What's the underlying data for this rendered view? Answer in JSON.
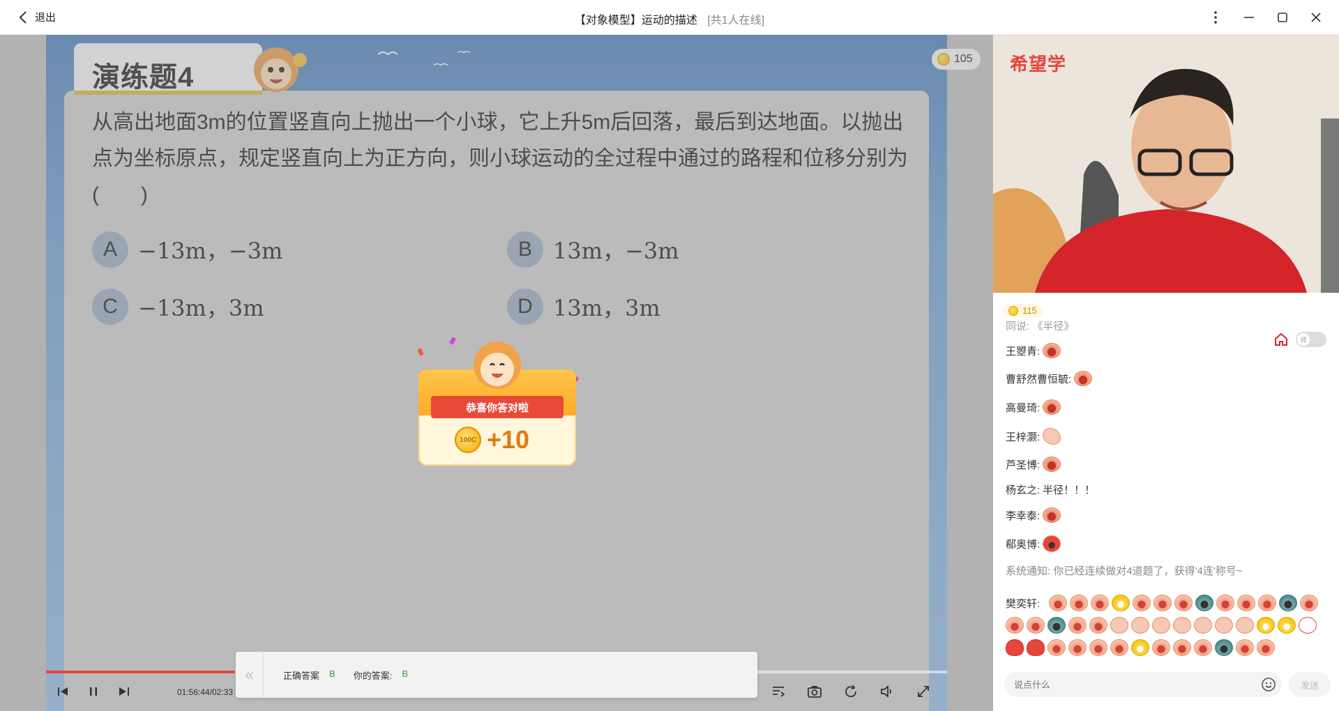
{
  "window": {
    "back_label": "退出",
    "title": "【对象模型】运动的描述",
    "online": "[共1人在线]"
  },
  "slide": {
    "tab_title": "演练题4",
    "coin_count": "105",
    "question": "从高出地面3m的位置竖直向上抛出一个小球，它上升5m后回落，最后到达地面。以抛出点为坐标原点，规定竖直向上为正方向，则小球运动的全过程中通过的路程和位移分别为(　　)",
    "options": [
      {
        "letter": "A",
        "text": "−13m，−3m"
      },
      {
        "letter": "B",
        "text": "13m，−3m"
      },
      {
        "letter": "C",
        "text": "−13m，3m"
      },
      {
        "letter": "D",
        "text": "13m，3m"
      }
    ]
  },
  "reward": {
    "banner": "恭喜你答对啦",
    "coin_label": "100C",
    "amount": "+10"
  },
  "player": {
    "time": "01:56:44/02:33",
    "progress": 0.21
  },
  "answer": {
    "correct_label": "正确答案",
    "correct_value": "B",
    "yours_label": "你的答案:",
    "yours_value": "B"
  },
  "sidebar": {
    "brand": "希望学",
    "coins": "115",
    "toggle_label": "师",
    "cut_msg": "同说: 《半径》",
    "messages": [
      {
        "name": "王曌青:",
        "text": ""
      },
      {
        "name": "曹舒然曹恒毓:",
        "text": ""
      },
      {
        "name": "高曼琦:",
        "text": ""
      },
      {
        "name": "王梓灏:",
        "text": ""
      },
      {
        "name": "芦圣博:",
        "text": ""
      },
      {
        "name": "杨玄之:",
        "text": "半径！！！"
      },
      {
        "name": "李幸泰:",
        "text": ""
      },
      {
        "name": "郗奥博:",
        "text": ""
      }
    ],
    "system": "系统通知: 你已经连续做对4道题了，获得'4连'称号~",
    "last_name": "樊奕轩:",
    "input_placeholder": "说点什么",
    "send_label": "发送"
  }
}
